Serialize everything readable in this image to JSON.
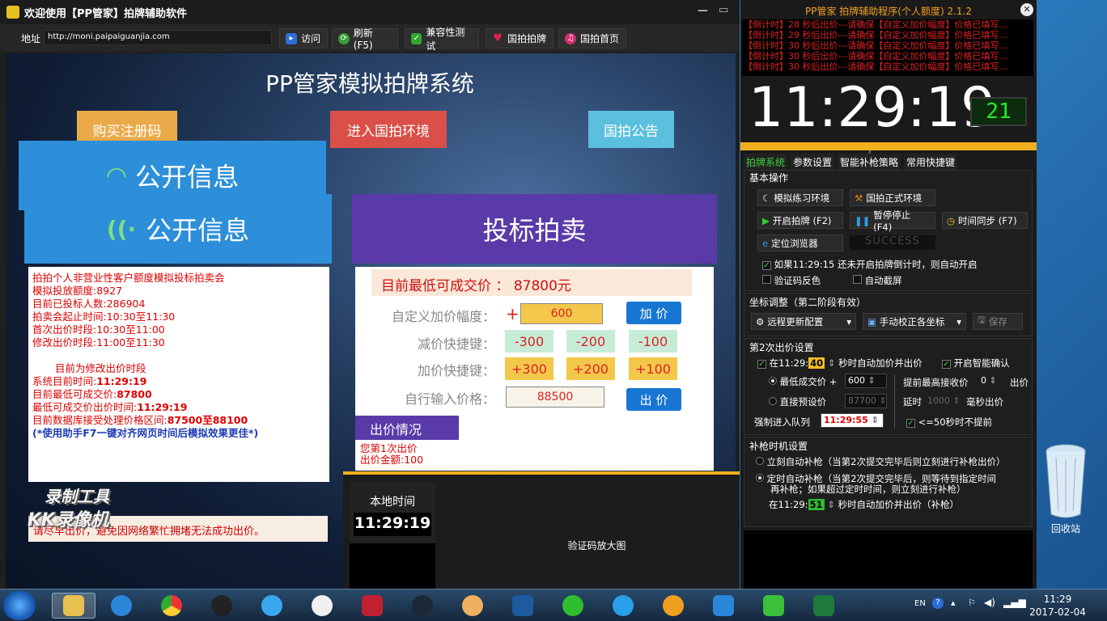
{
  "browser": {
    "title": "欢迎使用【PP管家】拍牌辅助软件",
    "address_label": "地址",
    "address": "http://moni.paipaiguanjia.com",
    "toolbar": {
      "visit": "访问",
      "refresh": "刷新(F5)",
      "compat": "兼容性测试",
      "guopai": "国拍拍牌",
      "home": "国拍首页"
    }
  },
  "page": {
    "title": "PP管家模拟拍牌系统",
    "buttons": {
      "buy": "购买注册码",
      "enter": "进入国拍环境",
      "notice": "国拍公告"
    },
    "buttons_colors": {
      "buy": "#ebaa4a",
      "enter": "#da4f47",
      "notice": "#5bc0de"
    },
    "public_info": {
      "heading": "公开信息",
      "lines": [
        "拍拍个人非营业性客户额度模拟投标拍卖会",
        "模拟投放额度:8927",
        "目前已投标人数:286904",
        "拍卖会起止时间:10:30至11:30",
        "首次出价时段:10:30至11:00",
        "修改出价时段:11:00至11:30",
        "",
        "目前为修改出价时段",
        "系统目前时间:",
        "目前最低可成交价:",
        "最低可成交价出价时间:",
        "目前数据库接受处理价格区间:"
      ],
      "system_time": "11:29:19",
      "lowest_price": "87800",
      "lowest_price_time": "11:29:19",
      "price_range": "87500至88100",
      "tip": "(*使用助手F7一键对齐网页时间后模拟效果更佳*)",
      "footer": "请尽早出价，避免因网络繁忙拥堵无法成功出价。"
    },
    "bidding": {
      "heading": "投标拍卖",
      "lowest_label": "目前最低可成交价 ：",
      "lowest_value": "87800元",
      "custom_label": "自定义加价幅度：",
      "custom_plus": "+",
      "custom_value": "600",
      "add_button": "加 价",
      "minus_label": "减价快捷键：",
      "minus_keys": [
        "-300",
        "-200",
        "-100"
      ],
      "plus_label": "加价快捷键：",
      "plus_keys": [
        "+300",
        "+200",
        "+100"
      ],
      "input_label": "自行输入价格：",
      "input_value": "88500",
      "bid_button": "出 价",
      "status_tab": "出价情况",
      "status_lines": [
        "您第1次出价",
        "出价金额:100"
      ]
    },
    "local_time_label": "本地时间",
    "local_time": "11:29:19",
    "captcha_label": "验证码放大图",
    "watermark_1": "录制工具",
    "watermark_2": "KK录像机"
  },
  "helper": {
    "title": "PP管家 拍牌辅助程序(个人额度) 2.1.2",
    "close": "✕",
    "log": [
      "【倒计时】28 秒后出价---请确保【自定义加价幅度】价格已填写...",
      "【倒计时】29 秒后出价---请确保【自定义加价幅度】价格已填写...",
      "【倒计时】30 秒后出价---请确保【自定义加价幅度】价格已填写...",
      "【倒计时】30 秒后出价---请确保【自定义加价幅度】价格已填写..."
    ],
    "clock": "11:29:19",
    "seconds": "21",
    "tabs": [
      "拍牌系统",
      "参数设置",
      "智能补枪策略",
      "常用快捷键"
    ],
    "basic": {
      "title": "基本操作",
      "sim_env": "模拟练习环境",
      "real_env": "国拍正式环境",
      "start": "开启拍牌 (F2)",
      "pause": "暂停停止 (F4)",
      "sync": "时间同步 (F7)",
      "locate": "定位浏览器",
      "status": "SUCCESS",
      "auto_open": "如果11:29:15 还未开启拍牌倒计时，则自动开启",
      "captcha_invert": "验证码反色",
      "auto_screenshot": "自动截屏"
    },
    "coords": {
      "title": "坐标调整（第二阶段有效）",
      "remote": "远程更新配置",
      "manual": "手动校正各坐标",
      "save": "保存"
    },
    "second_bid": {
      "title": "第2次出价设置",
      "at_prefix": "在11:29:",
      "at_sec": "40",
      "at_suffix": "秒时自动加价并出价",
      "smart_confirm": "开启智能确认",
      "lowest_plus": "最低成交价 +",
      "lowest_plus_val": "600",
      "direct": "直接预设价",
      "direct_val": "87700",
      "advance": "提前最高接收价",
      "advance_val": "0",
      "advance_suffix": "出价",
      "delay": "延时",
      "delay_val": "1000",
      "delay_suffix": "毫秒出价",
      "force_queue": "强制进入队列",
      "force_time": "11:29:55",
      "no_advance": "<=50秒时不提前"
    },
    "backup": {
      "title": "补枪时机设置",
      "opt1": "立刻自动补枪（当第2次提交完毕后则立刻进行补枪出价）",
      "opt2a": "定时自动补枪（当第2次提交完毕后，则等待到指定时间",
      "opt2b": "再补枪；如果超过定时时间，则立刻进行补枪）",
      "at_prefix": "在11:29:",
      "at_sec": "51",
      "at_suffix": "秒时自动加价并出价（补枪）"
    }
  },
  "desktop": {
    "recycle_bin": "回收站"
  },
  "taskbar": {
    "lang": "EN",
    "time": "11:29",
    "date": "2017-02-04"
  }
}
